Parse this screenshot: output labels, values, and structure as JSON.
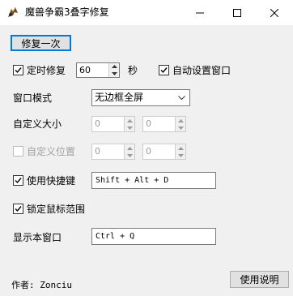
{
  "window": {
    "title": "魔兽争霸3叠字修复",
    "icons": [
      "app-icon",
      "minimize-icon",
      "maximize-icon",
      "close-icon"
    ]
  },
  "repair_once": {
    "label": "修复一次"
  },
  "timed_repair": {
    "label": "定时修复",
    "checked": true,
    "value": "60",
    "unit": "秒"
  },
  "auto_window": {
    "label": "自动设置窗口",
    "checked": true
  },
  "window_mode": {
    "label": "窗口模式",
    "selected": "无边框全屏"
  },
  "custom_size": {
    "label": "自定义大小",
    "width": "0",
    "height": "0"
  },
  "custom_position": {
    "label": "自定义位置",
    "checked": false,
    "x": "0",
    "y": "0"
  },
  "hotkey": {
    "label": "使用快捷键",
    "checked": true,
    "value": "Shift + Alt + D"
  },
  "lock_mouse": {
    "label": "锁定鼠标范围",
    "checked": true
  },
  "show_window": {
    "label": "显示本窗口",
    "value": "Ctrl + Q"
  },
  "footer": {
    "author": "作者: Zonciu",
    "help_label": "使用说明"
  },
  "colors": {
    "focus": "#0078d7",
    "face": "#f0f0f0",
    "disabled_text": "#a0a0a0"
  }
}
